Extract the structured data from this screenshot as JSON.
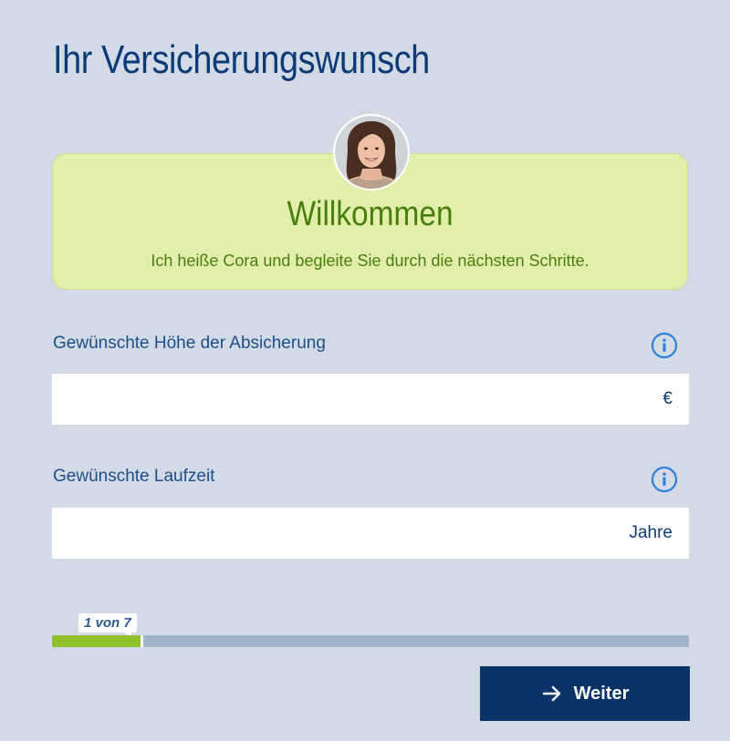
{
  "page": {
    "title": "Ihr Versicherungswunsch"
  },
  "welcome": {
    "title": "Willkommen",
    "text": "Ich heiße Cora und begleite Sie durch die nächsten Schritte.",
    "avatar_icon": "avatar-photo"
  },
  "fields": [
    {
      "label": "Gewünschte Höhe der Absicherung",
      "value": "",
      "placeholder": "",
      "unit": "€",
      "icon": "info-icon"
    },
    {
      "label": "Gewünschte Laufzeit",
      "value": "",
      "placeholder": "",
      "unit": "Jahre",
      "icon": "info-icon"
    }
  ],
  "progress": {
    "label": "1 von 7",
    "current_step": 1,
    "total_steps": 7
  },
  "actions": {
    "next_label": "Weiter",
    "next_icon": "arrow-right-icon"
  },
  "colors": {
    "background": "#d3dae6",
    "primary": "#0b3366",
    "accent_green": "#8fbf2a",
    "welcome_bg": "#e1efaa",
    "welcome_text": "#4a7d10",
    "info_icon": "#2f80d6"
  }
}
